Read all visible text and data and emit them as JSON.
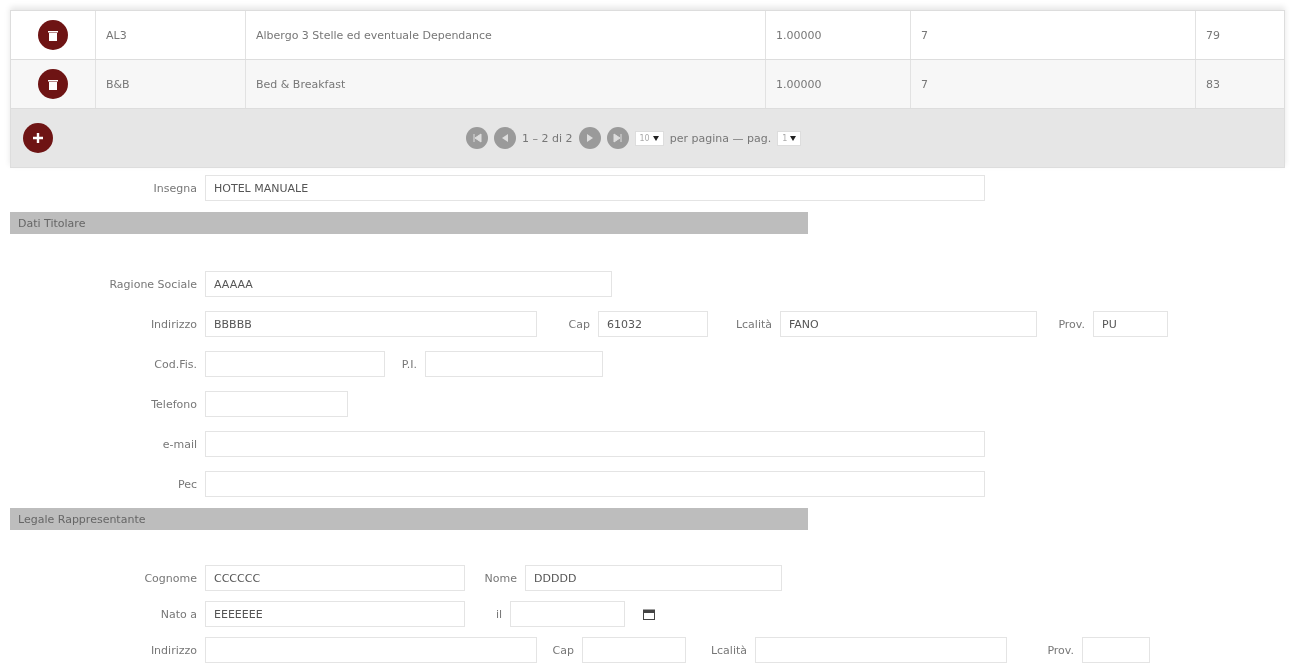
{
  "table": {
    "rows": [
      {
        "code": "AL3",
        "description": "Albergo 3 Stelle ed eventuale Dependance",
        "value": "1.00000",
        "column_5": "7",
        "column_6": "79"
      },
      {
        "code": "B&B",
        "description": "Bed & Breakfast",
        "value": "1.00000",
        "column_5": "7",
        "column_6": "83"
      }
    ]
  },
  "pager": {
    "range": "1 – 2 di 2",
    "page_size": "10",
    "per_page_label": "per pagina — pag.",
    "page": "1"
  },
  "header_row": {
    "items": [
      {
        "kind": "text",
        "label": "Insegna",
        "value": "HOTEL MANUALE"
      }
    ]
  },
  "sections": [
    {
      "title": "Dati Titolare",
      "rows": [
        {
          "items": [
            {
              "kind": "text",
              "label": "Ragione Sociale",
              "value": "AAAAA"
            }
          ]
        },
        {
          "items": [
            {
              "kind": "text",
              "label": "Indirizzo",
              "value": "BBBBB"
            },
            {
              "kind": "text",
              "label": "Cap",
              "value": "61032"
            },
            {
              "kind": "text",
              "label": "Lcalità",
              "value": "FANO"
            },
            {
              "kind": "text",
              "label": "Prov.",
              "value": "PU"
            }
          ]
        },
        {
          "items": [
            {
              "kind": "text",
              "label": "Cod.Fis."
            },
            {
              "kind": "text",
              "label": "P.I."
            }
          ]
        },
        {
          "items": [
            {
              "kind": "text",
              "label": "Telefono"
            }
          ]
        },
        {
          "items": [
            {
              "kind": "text",
              "label": "e-mail"
            }
          ]
        },
        {
          "items": [
            {
              "kind": "text",
              "label": "Pec"
            }
          ]
        }
      ]
    },
    {
      "title": "Legale Rappresentante",
      "rows": [
        {
          "items": [
            {
              "kind": "text",
              "label": "Cognome",
              "value": "CCCCCC"
            },
            {
              "kind": "text",
              "label": "Nome",
              "value": "DDDDD"
            }
          ]
        },
        {
          "items": [
            {
              "kind": "text",
              "label": "Nato a",
              "value": "EEEEEEE"
            },
            {
              "kind": "date",
              "label": "il"
            }
          ]
        },
        {
          "items": [
            {
              "kind": "text",
              "label": "Indirizzo"
            },
            {
              "kind": "text",
              "label": "Cap"
            },
            {
              "kind": "text",
              "label": "Lcalità"
            },
            {
              "kind": "text",
              "label": "Prov."
            }
          ]
        }
      ]
    }
  ]
}
